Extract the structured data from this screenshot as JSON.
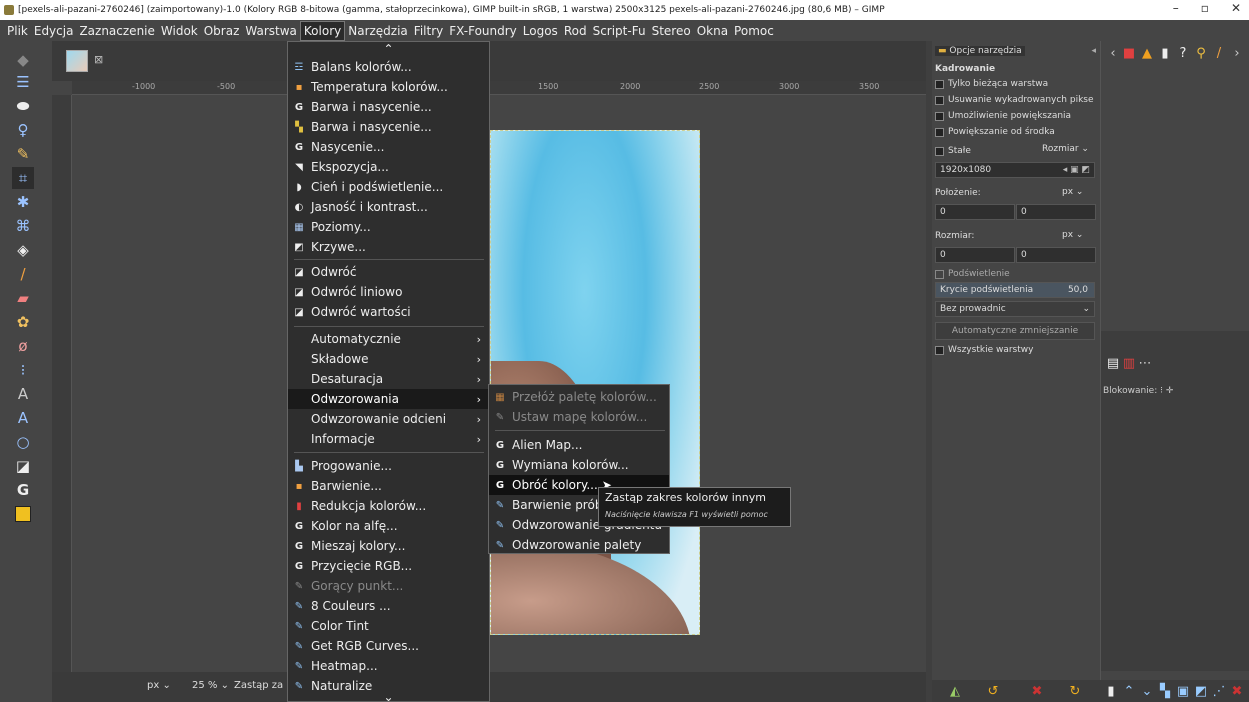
{
  "window": {
    "title": "[pexels-ali-pazani-2760246] (zaimportowany)-1.0 (Kolory RGB 8-bitowa (gamma, stałoprzecinkowa), GIMP built-in sRGB, 1 warstwa) 2500x3125 pexels-ali-pazani-2760246.jpg (80,6 MB) – GIMP",
    "minimize": "–",
    "maximize": "▫",
    "close": "✕"
  },
  "menubar": [
    "Plik",
    "Edycja",
    "Zaznaczenie",
    "Widok",
    "Obraz",
    "Warstwa",
    "Kolory",
    "Narzędzia",
    "Filtry",
    "FX-Foundry",
    "Logos",
    "Rod",
    "Script-Fu",
    "Stereo",
    "Okna",
    "Pomoc"
  ],
  "ruler": {
    "h_ticks": [
      "-1000",
      "-500",
      "1500",
      "2000",
      "2500",
      "3000",
      "3500"
    ]
  },
  "colors_menu": {
    "items": [
      {
        "icon": "balance-icon",
        "label": "Balans kolorów..."
      },
      {
        "icon": "temperature-icon",
        "label": "Temperatura kolorów..."
      },
      {
        "icon": "gegl-icon",
        "label": "Barwa i nasycenie..."
      },
      {
        "icon": "hue-icon",
        "label": "Barwa i nasycenie..."
      },
      {
        "icon": "gegl-icon",
        "label": "Nasycenie..."
      },
      {
        "icon": "exposure-icon",
        "label": "Ekspozycja..."
      },
      {
        "icon": "shadows-icon",
        "label": "Cień i podświetlenie..."
      },
      {
        "icon": "contrast-icon",
        "label": "Jasność i kontrast..."
      },
      {
        "icon": "levels-icon",
        "label": "Poziomy..."
      },
      {
        "icon": "curves-icon",
        "label": "Krzywe..."
      },
      {
        "icon": "invert-icon",
        "label": "Odwróć"
      },
      {
        "icon": "invert-icon",
        "label": "Odwróć liniowo"
      },
      {
        "icon": "invert-icon",
        "label": "Odwróć wartości"
      },
      {
        "label": "Automatycznie",
        "arrow": "›"
      },
      {
        "label": "Składowe",
        "arrow": "›"
      },
      {
        "label": "Desaturacja",
        "arrow": "›"
      },
      {
        "label": "Odwzorowania",
        "arrow": "›"
      },
      {
        "label": "Odwzorowanie odcieni",
        "arrow": "›"
      },
      {
        "label": "Informacje",
        "arrow": "›"
      },
      {
        "icon": "threshold-icon",
        "label": "Progowanie..."
      },
      {
        "icon": "colorize-icon",
        "label": "Barwienie..."
      },
      {
        "icon": "reduce-icon",
        "label": "Redukcja kolorów..."
      },
      {
        "icon": "gegl-icon",
        "label": "Kolor na alfę..."
      },
      {
        "icon": "gegl-icon",
        "label": "Mieszaj kolory..."
      },
      {
        "icon": "gegl-icon",
        "label": "Przycięcie RGB..."
      },
      {
        "icon": "script-icon",
        "label": "Gorący punkt..."
      },
      {
        "icon": "script-icon",
        "label": "8 Couleurs ..."
      },
      {
        "icon": "script-icon",
        "label": "Color Tint"
      },
      {
        "icon": "script-icon",
        "label": "Get RGB Curves..."
      },
      {
        "icon": "script-icon",
        "label": "Heatmap..."
      },
      {
        "icon": "script-icon",
        "label": "Naturalize"
      }
    ],
    "scroll_up": "⌃",
    "scroll_down": "⌄"
  },
  "submenu": {
    "items": [
      {
        "icon": "palette-icon",
        "label": "Przełóż paletę kolorów..."
      },
      {
        "icon": "script-icon",
        "label": "Ustaw mapę kolorów..."
      },
      {
        "icon": "gegl-icon",
        "label": "Alien Map..."
      },
      {
        "icon": "gegl-icon",
        "label": "Wymiana kolorów..."
      },
      {
        "icon": "gegl-icon",
        "label": "Obróć kolory..."
      },
      {
        "icon": "script-icon",
        "label": "Barwienie próbek..."
      },
      {
        "icon": "script-icon",
        "label": "Odwzorowanie gradientu"
      },
      {
        "icon": "script-icon",
        "label": "Odwzorowanie palety"
      }
    ]
  },
  "tooltip": {
    "title": "Zastąp zakres kolorów innym",
    "help": "Naciśnięcie klawisza F1 wyświetli pomoc"
  },
  "tool_options": {
    "tab": "Opcje narzędzia",
    "tool_name": "Kadrowanie",
    "only_current": "Tylko bieżąca warstwa",
    "delete_cropped": "Usuwanie wykadrowanych pikse",
    "allow_grow": "Umożliwienie powiększania",
    "grow_center": "Powiększanie od środka",
    "fixed": "Stałe",
    "fixed_mode": "Rozmiar",
    "fixed_value": "1920x1080",
    "position_label": "Położenie:",
    "position_unit": "px",
    "pos_x": "0",
    "pos_y": "0",
    "size_label": "Rozmiar:",
    "size_unit": "px",
    "size_x": "0",
    "size_y": "0",
    "highlight_label": "Podświetlenie",
    "highlight_opacity_label": "Krycie podświetlenia",
    "highlight_opacity_value": "50,0",
    "guides": "Bez prowadnic",
    "auto_shrink": "Automatyczne zmniejszanie",
    "all_layers": "Wszystkie warstwy"
  },
  "layers": {
    "lock_label": "Blokowanie:"
  },
  "statusbar": {
    "unit": "px",
    "zoom": "25 %",
    "message": "Zastąp za"
  }
}
